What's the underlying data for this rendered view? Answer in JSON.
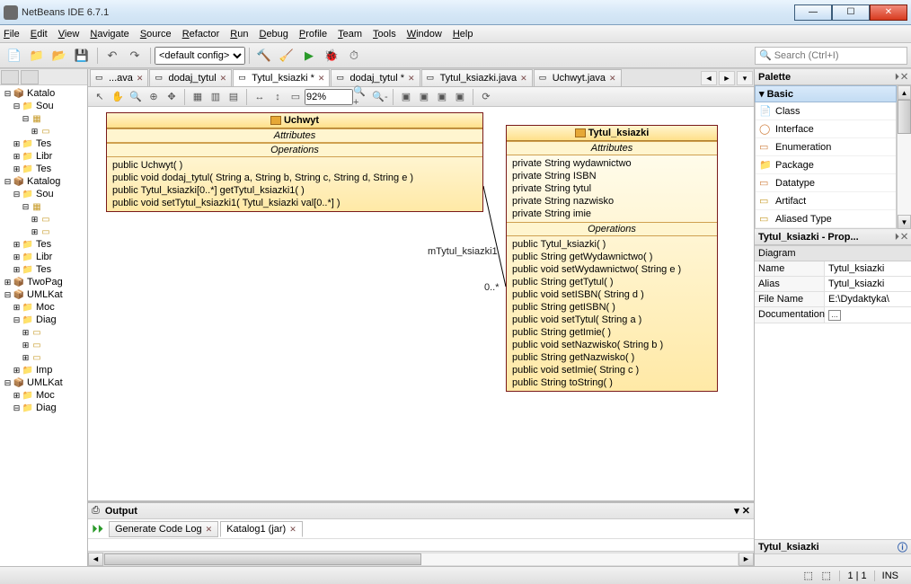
{
  "window": {
    "title": "NetBeans IDE 6.7.1"
  },
  "menu": {
    "items": [
      "File",
      "Edit",
      "View",
      "Navigate",
      "Source",
      "Refactor",
      "Run",
      "Debug",
      "Profile",
      "Team",
      "Tools",
      "Window",
      "Help"
    ]
  },
  "toolbar": {
    "config_selected": "<default config>",
    "search_placeholder": "Search (Ctrl+I)"
  },
  "tree": {
    "nodes": [
      {
        "t": "Katalo",
        "lvl": 0,
        "icon": "proj",
        "exp": "-"
      },
      {
        "t": "Sou",
        "lvl": 1,
        "icon": "folder",
        "exp": "-"
      },
      {
        "t": "",
        "lvl": 2,
        "icon": "pkg",
        "exp": "-"
      },
      {
        "t": "",
        "lvl": 3,
        "icon": "cls",
        "exp": "+"
      },
      {
        "t": "Tes",
        "lvl": 1,
        "icon": "folder",
        "exp": "+"
      },
      {
        "t": "Libr",
        "lvl": 1,
        "icon": "folder",
        "exp": "+"
      },
      {
        "t": "Tes",
        "lvl": 1,
        "icon": "folder",
        "exp": "+"
      },
      {
        "t": "Katalog",
        "lvl": 0,
        "icon": "proj",
        "exp": "-"
      },
      {
        "t": "Sou",
        "lvl": 1,
        "icon": "folder",
        "exp": "-"
      },
      {
        "t": "",
        "lvl": 2,
        "icon": "pkg",
        "exp": "-"
      },
      {
        "t": "",
        "lvl": 3,
        "icon": "cls",
        "exp": "+"
      },
      {
        "t": "",
        "lvl": 3,
        "icon": "cls",
        "exp": "+"
      },
      {
        "t": "Tes",
        "lvl": 1,
        "icon": "folder",
        "exp": "+"
      },
      {
        "t": "Libr",
        "lvl": 1,
        "icon": "folder",
        "exp": "+"
      },
      {
        "t": "Tes",
        "lvl": 1,
        "icon": "folder",
        "exp": "+"
      },
      {
        "t": "TwoPag",
        "lvl": 0,
        "icon": "proj",
        "exp": "+"
      },
      {
        "t": "UMLKat",
        "lvl": 0,
        "icon": "proj",
        "exp": "-"
      },
      {
        "t": "Moc",
        "lvl": 1,
        "icon": "folder",
        "exp": "+"
      },
      {
        "t": "Diag",
        "lvl": 1,
        "icon": "folder",
        "exp": "-"
      },
      {
        "t": "",
        "lvl": 2,
        "icon": "cls",
        "exp": "+"
      },
      {
        "t": "",
        "lvl": 2,
        "icon": "cls",
        "exp": "+"
      },
      {
        "t": "",
        "lvl": 2,
        "icon": "cls",
        "exp": "+"
      },
      {
        "t": "Imp",
        "lvl": 1,
        "icon": "folder",
        "exp": "+"
      },
      {
        "t": "UMLKat",
        "lvl": 0,
        "icon": "proj",
        "exp": "-"
      },
      {
        "t": "Moc",
        "lvl": 1,
        "icon": "folder",
        "exp": "+"
      },
      {
        "t": "Diag",
        "lvl": 1,
        "icon": "folder",
        "exp": "-"
      }
    ]
  },
  "tabs": [
    {
      "label": "...ava",
      "active": false,
      "close": true
    },
    {
      "label": "dodaj_tytul",
      "active": false,
      "close": true
    },
    {
      "label": "Tytul_ksiazki *",
      "active": true,
      "close": true
    },
    {
      "label": "dodaj_tytul *",
      "active": false,
      "close": true
    },
    {
      "label": "Tytul_ksiazki.java",
      "active": false,
      "close": true
    },
    {
      "label": "Uchwyt.java",
      "active": false,
      "close": true
    }
  ],
  "diagram_toolbar": {
    "zoom": "92%"
  },
  "uml": {
    "uchwyt": {
      "name": "Uchwyt",
      "attributes_header": "Attributes",
      "operations_header": "Operations",
      "ops": [
        "public Uchwyt( )",
        "public void  dodaj_tytul( String a, String b, String c, String d, String e )",
        "public Tytul_ksiazki[0..*]  getTytul_ksiazki1( )",
        "public void  setTytul_ksiazki1( Tytul_ksiazki val[0..*] )"
      ]
    },
    "tytul": {
      "name": "Tytul_ksiazki",
      "attributes_header": "Attributes",
      "operations_header": "Operations",
      "attrs": [
        "private String wydawnictwo",
        "private String ISBN",
        "private String tytul",
        "private String nazwisko",
        "private String imie"
      ],
      "ops": [
        "public Tytul_ksiazki( )",
        "public String  getWydawnictwo( )",
        "public void  setWydawnictwo( String e )",
        "public String  getTytul( )",
        "public void  setISBN( String d )",
        "public String  getISBN( )",
        "public void  setTytul( String a )",
        "public String  getImie( )",
        "public void  setNazwisko( String b )",
        "public String  getNazwisko( )",
        "public void  setImie( String c )",
        "public String  toString( )"
      ]
    },
    "assoc_role": "mTytul_ksiazki1",
    "assoc_mult": "0..*"
  },
  "output": {
    "title": "Output",
    "tabs": [
      {
        "label": "Generate Code Log",
        "close": true,
        "active": false
      },
      {
        "label": "Katalog1 (jar)",
        "close": true,
        "active": true
      }
    ]
  },
  "palette": {
    "title": "Palette",
    "category": "Basic",
    "items": [
      {
        "label": "Class",
        "icon": "📄",
        "color": "#c79b2a"
      },
      {
        "label": "Interface",
        "icon": "◯",
        "color": "#d08040"
      },
      {
        "label": "Enumeration",
        "icon": "▭",
        "color": "#d08040"
      },
      {
        "label": "Package",
        "icon": "📁",
        "color": "#3a9a3a"
      },
      {
        "label": "Datatype",
        "icon": "▭",
        "color": "#d08040"
      },
      {
        "label": "Artifact",
        "icon": "▭",
        "color": "#c79b2a"
      },
      {
        "label": "Aliased Type",
        "icon": "▭",
        "color": "#c79b2a"
      }
    ]
  },
  "properties": {
    "title": "Tytul_ksiazki - Prop...",
    "section": "Diagram",
    "rows": [
      {
        "k": "Name",
        "v": "Tytul_ksiazki"
      },
      {
        "k": "Alias",
        "v": "Tytul_ksiazki"
      },
      {
        "k": "File Name",
        "v": "E:\\Dydaktyka\\"
      },
      {
        "k": "Documentation",
        "v": ""
      }
    ]
  },
  "bottom_panel": {
    "title": "Tytul_ksiazki"
  },
  "statusbar": {
    "pos": "1 | 1",
    "mode": "INS"
  }
}
